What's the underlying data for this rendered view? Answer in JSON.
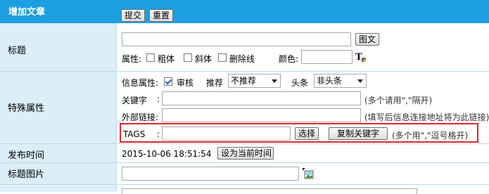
{
  "header": {
    "title": "增加文章",
    "submit_label": "提交",
    "reset_label": "重置"
  },
  "title_row": {
    "label": "标题",
    "image_text_button": "图文",
    "attributes_label": "属性:",
    "bold_label": "粗体",
    "italic_label": "斜体",
    "strike_label": "删除线",
    "color_label": "颜色:"
  },
  "special": {
    "label": "特殊属性",
    "info_attr_label": "信息属性:",
    "review_label": "审核",
    "recommend_label": "推荐",
    "recommend_value": "不推荐",
    "headline_label": "头条",
    "headline_value": "非头条",
    "keyword_label": "关键字",
    "keyword_colon": ":",
    "keyword_hint": "(多个请用\",\"隔开)",
    "external_link_label": "外部链接:",
    "external_link_hint": "(填写后信息连接地址将为此链接)",
    "tags_label": "TAGS",
    "tags_colon": ":",
    "choose_label": "选择",
    "copy_keywords_label": "复制关键字",
    "tags_hint": "(多个用\",\"逗号格开)"
  },
  "publish": {
    "label": "发布时间",
    "value": "2015-10-06 18:51:54",
    "set_now_label": "设为当前时间"
  },
  "title_image": {
    "label": "标题图片"
  },
  "colors": {
    "header_bg": "#1e9fe2",
    "label_bg": "#dceef8",
    "highlight_border": "#e0262b"
  }
}
